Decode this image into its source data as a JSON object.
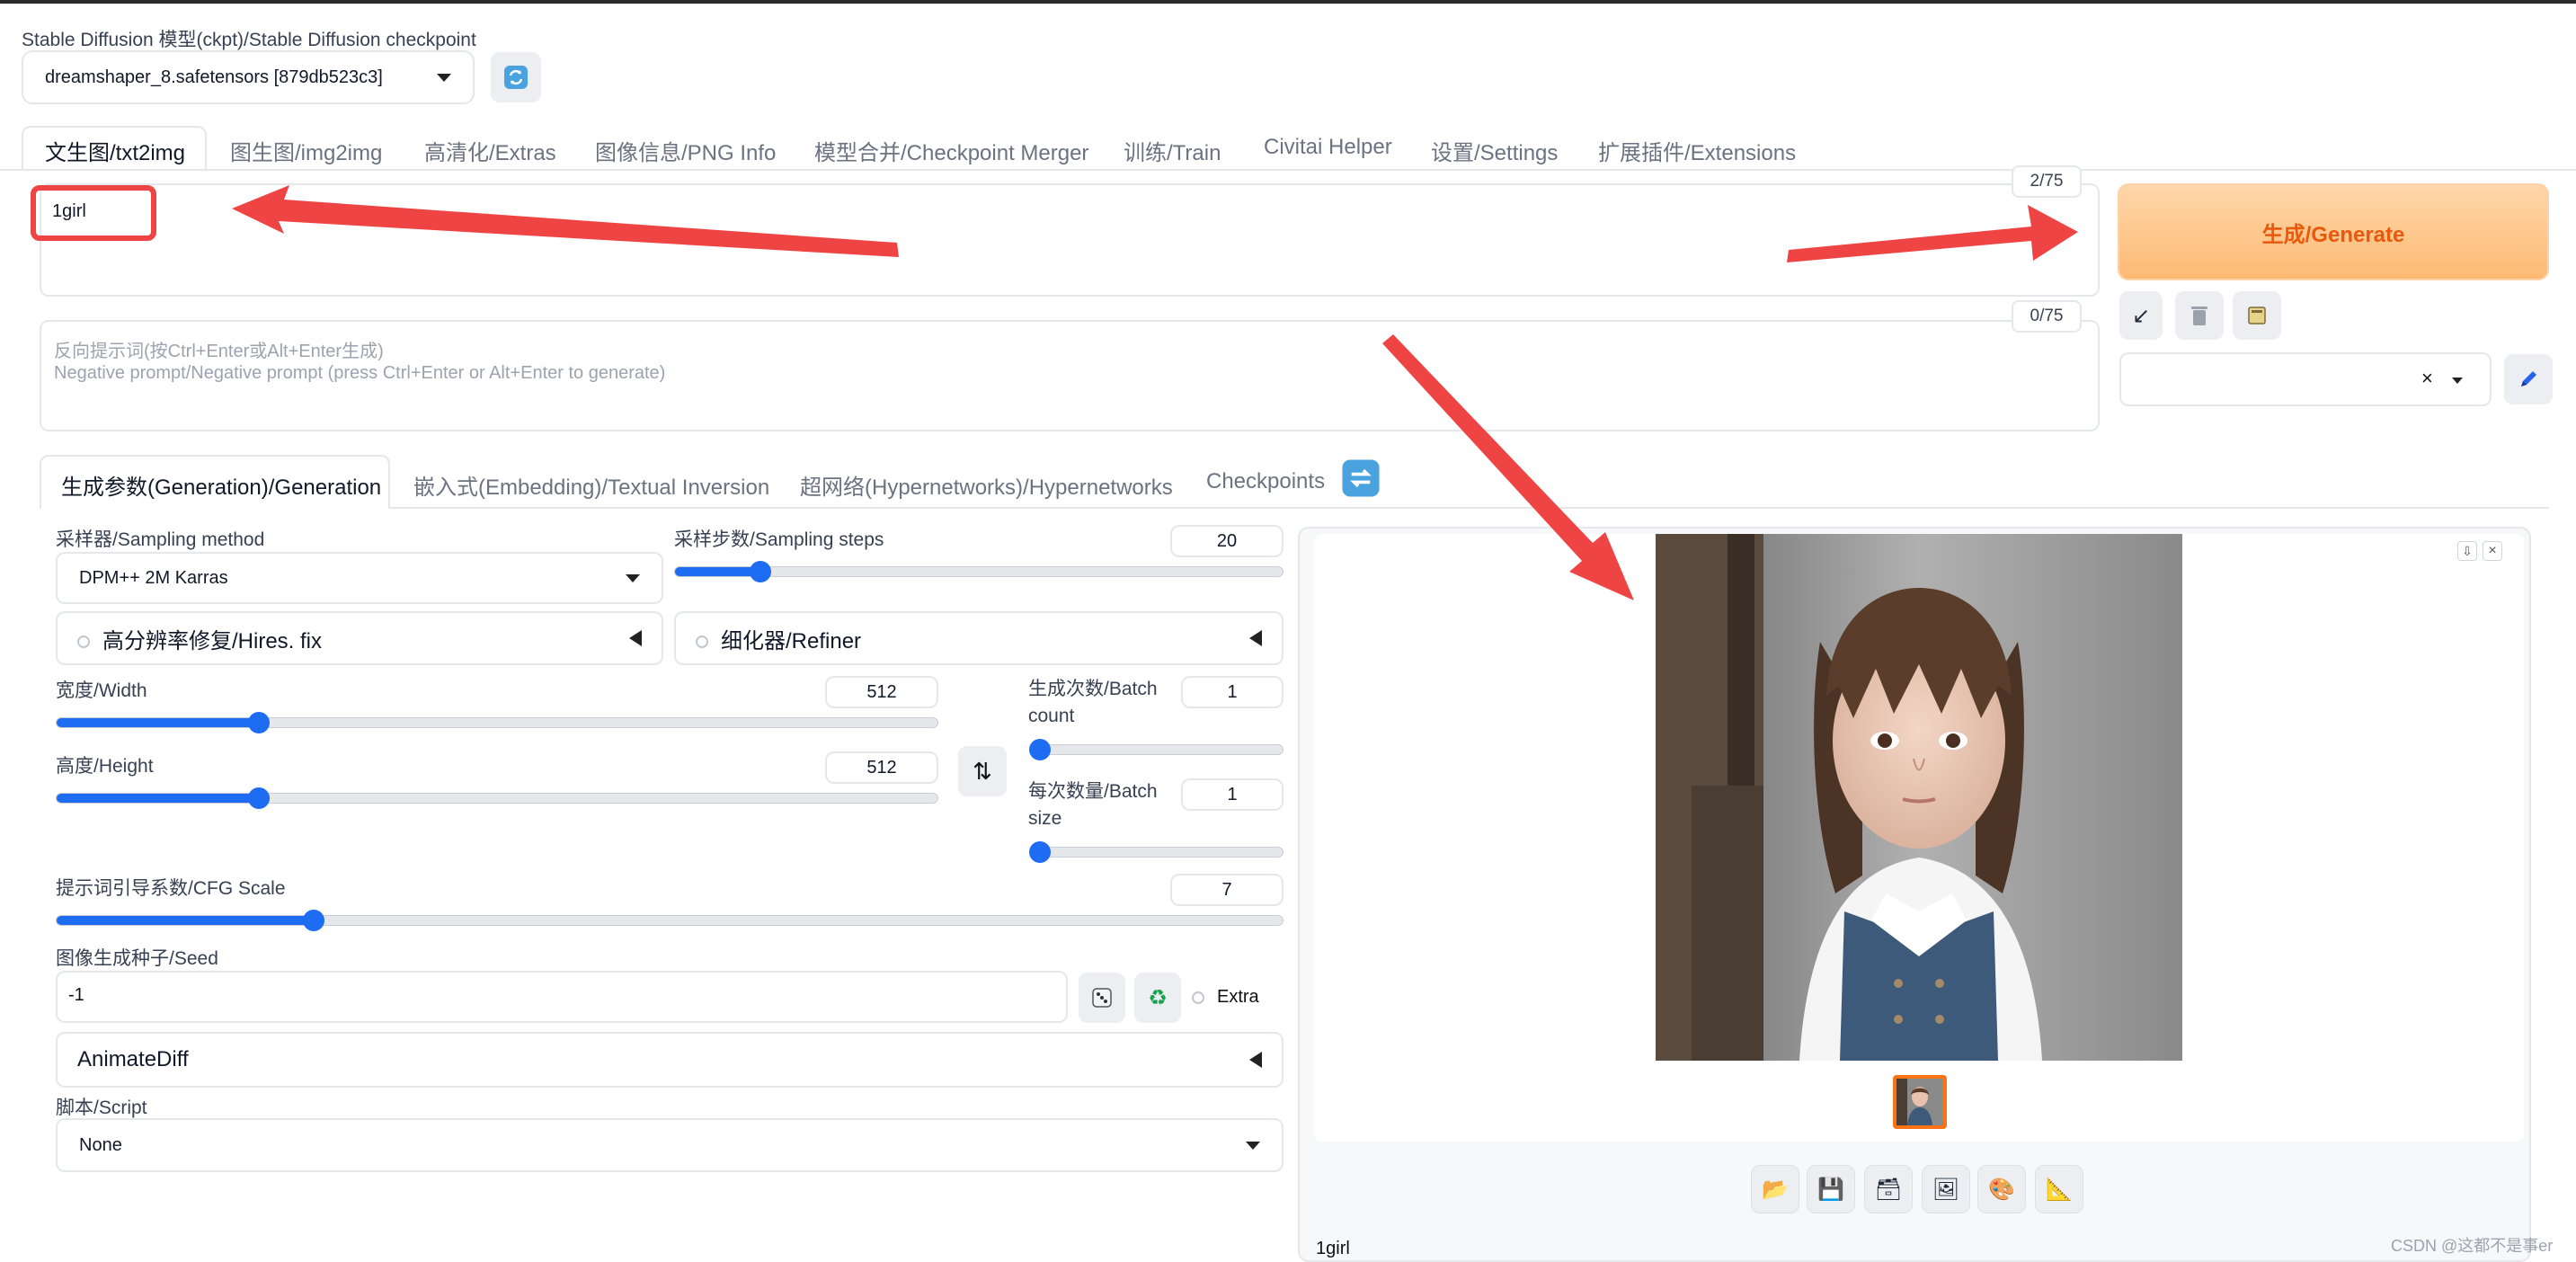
{
  "checkpoint": {
    "label": "Stable Diffusion 模型(ckpt)/Stable Diffusion checkpoint",
    "value": "dreamshaper_8.safetensors [879db523c3]"
  },
  "tabs": [
    {
      "label": "文生图/txt2img"
    },
    {
      "label": "图生图/img2img"
    },
    {
      "label": "高清化/Extras"
    },
    {
      "label": "图像信息/PNG Info"
    },
    {
      "label": "模型合并/Checkpoint Merger"
    },
    {
      "label": "训练/Train"
    },
    {
      "label": "Civitai Helper"
    },
    {
      "label": "设置/Settings"
    },
    {
      "label": "扩展插件/Extensions"
    }
  ],
  "prompt": {
    "value": "1girl",
    "token_count": "2/75"
  },
  "negative_prompt": {
    "placeholder_line1": "反向提示词(按Ctrl+Enter或Alt+Enter生成)",
    "placeholder_line2": "Negative prompt/Negative prompt (press Ctrl+Enter or Alt+Enter to generate)",
    "token_count": "0/75"
  },
  "generate": {
    "label": "生成/Generate",
    "color": "#ea580c"
  },
  "subtabs": [
    {
      "label": "生成参数(Generation)/Generation"
    },
    {
      "label": "嵌入式(Embedding)/Textual Inversion"
    },
    {
      "label": "超网络(Hypernetworks)/Hypernetworks"
    },
    {
      "label": "Checkpoints"
    }
  ],
  "params": {
    "sampler_label": "采样器/Sampling method",
    "sampler_value": "DPM++ 2M Karras",
    "steps_label": "采样步数/Sampling steps",
    "steps_value": "20",
    "steps_fraction": 0.14,
    "hires_label": "高分辨率修复/Hires. fix",
    "refiner_label": "细化器/Refiner",
    "width_label": "宽度/Width",
    "width_value": "512",
    "width_fraction": 0.23,
    "height_label": "高度/Height",
    "height_value": "512",
    "height_fraction": 0.23,
    "batch_count_label": "生成次数/Batch count",
    "batch_count_value": "1",
    "batch_count_fraction": 0.0,
    "batch_size_label": "每次数量/Batch size",
    "batch_size_value": "1",
    "batch_size_fraction": 0.0,
    "cfg_label": "提示词引导系数/CFG Scale",
    "cfg_value": "7",
    "cfg_fraction": 0.21,
    "seed_label": "图像生成种子/Seed",
    "seed_value": "-1",
    "extra_label": "Extra",
    "animatediff_label": "AnimateDiff",
    "script_label": "脚本/Script",
    "script_value": "None"
  },
  "output": {
    "caption": "1girl"
  },
  "watermark": "CSDN @这都不是事er",
  "colors": {
    "accent": "#1d6cf1",
    "annotation_red": "#ef4444",
    "generate_bg": "#fdba74"
  }
}
